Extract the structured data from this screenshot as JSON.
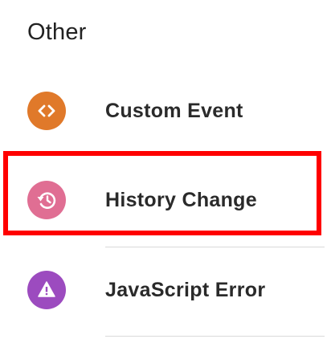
{
  "section": {
    "title": "Other"
  },
  "items": [
    {
      "label": "Custom Event",
      "icon": "code-icon",
      "color": "#e0792a"
    },
    {
      "label": "History Change",
      "icon": "history-icon",
      "color": "#e06e93"
    },
    {
      "label": "JavaScript Error",
      "icon": "warning-icon",
      "color": "#9c4bbf"
    }
  ],
  "highlight": {
    "color": "#ff0000"
  }
}
